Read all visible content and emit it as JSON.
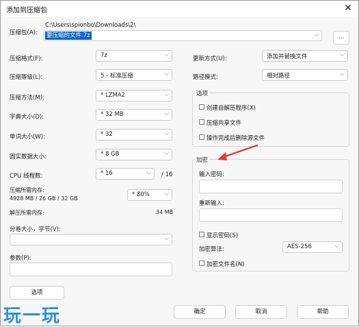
{
  "window": {
    "title": "添加到压缩包",
    "close_glyph": "✕"
  },
  "archive": {
    "label": "压缩包(A):",
    "path": "C:\\Users\\spionbo\\Downloads\\2\\",
    "name": "要压缩的文件.7z",
    "browse_label": "..."
  },
  "left": {
    "format_label": "压缩格式(F):",
    "format_value": "7z",
    "level_label": "压缩等级(L):",
    "level_value": "5 - 标准压缩",
    "method_label": "压缩方法(M):",
    "method_value": "* LZMA2",
    "dict_label": "字典大小(D):",
    "dict_value": "* 32 MB",
    "word_label": "单词大小(W):",
    "word_value": "* 32",
    "solid_label": "固实数据大小:",
    "solid_value": "* 8 GB",
    "cpu_label": "CPU 线程数:",
    "cpu_value": "* 16",
    "cpu_total": "/ 16",
    "mem_label": "压缩所需内存:",
    "mem_detail": "4928 MB / 26 GB / 32 GB",
    "mem_value": "* 80%",
    "decomp_label": "解压所需内存:",
    "decomp_value": "34 MB",
    "split_label": "分卷大小，字节(V):",
    "split_value": "",
    "params_label": "参数(P):",
    "params_value": "",
    "options_button": "选项"
  },
  "right": {
    "update_label": "更新方式(U):",
    "update_value": "添加并替换文件",
    "pathmode_label": "路径模式:",
    "pathmode_value": "相对路径",
    "options_group": "选项",
    "opt_sfx": "创建自解压程序(X)",
    "opt_shared": "压缩共享文件",
    "opt_delete": "操作完成后删除源文件",
    "encrypt_group": "加密",
    "pwd_label": "输入密码:",
    "pwd_value": "",
    "repwd_label": "重新输入:",
    "repwd_value": "",
    "show_pwd": "显示密码(S)",
    "enc_method_label": "加密算法:",
    "enc_method_value": "AES-256",
    "enc_names": "加密文件名(N)"
  },
  "buttons": {
    "ok": "确定",
    "cancel": "取消",
    "help": "帮助"
  },
  "watermark": "玩一玩",
  "colors": {
    "selection": "#0a64c8",
    "arrow": "#e53935",
    "watermark": "#2b90d9"
  }
}
